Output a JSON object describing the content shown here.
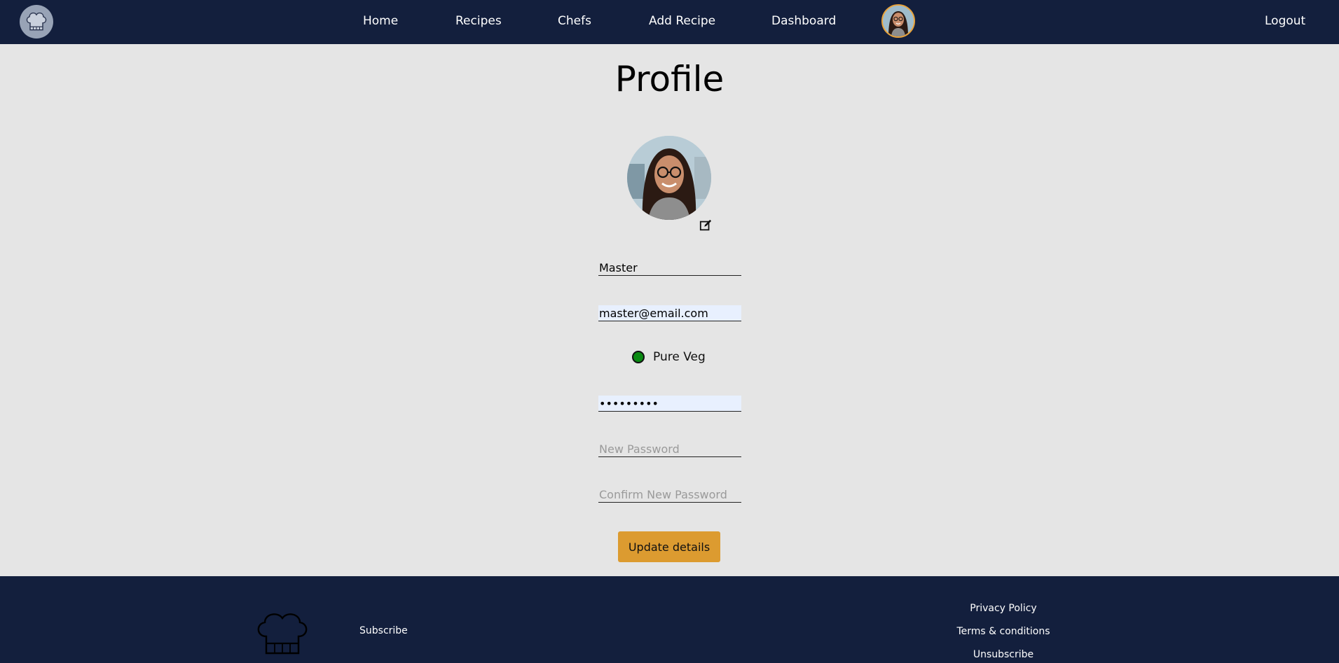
{
  "nav": {
    "logo_icon": "chef-hat-icon",
    "links": [
      "Home",
      "Recipes",
      "Chefs",
      "Add Recipe",
      "Dashboard"
    ],
    "logout": "Logout"
  },
  "profile": {
    "title": "Profile",
    "name_value": "Master",
    "email_value": "master@email.com",
    "preference": "Pure Veg",
    "preference_color": "#0a8a12",
    "password_value": "•••••••••",
    "new_password_placeholder": "New Password",
    "confirm_password_placeholder": "Confirm New Password",
    "update_label": "Update details"
  },
  "footer": {
    "subscribe": "Subscribe",
    "links": [
      "Privacy Policy",
      "Terms & conditions",
      "Unsubscribe"
    ]
  },
  "colors": {
    "nav_bg": "#131f3d",
    "page_bg": "#e5e5e5",
    "accent": "#dc9b30"
  }
}
